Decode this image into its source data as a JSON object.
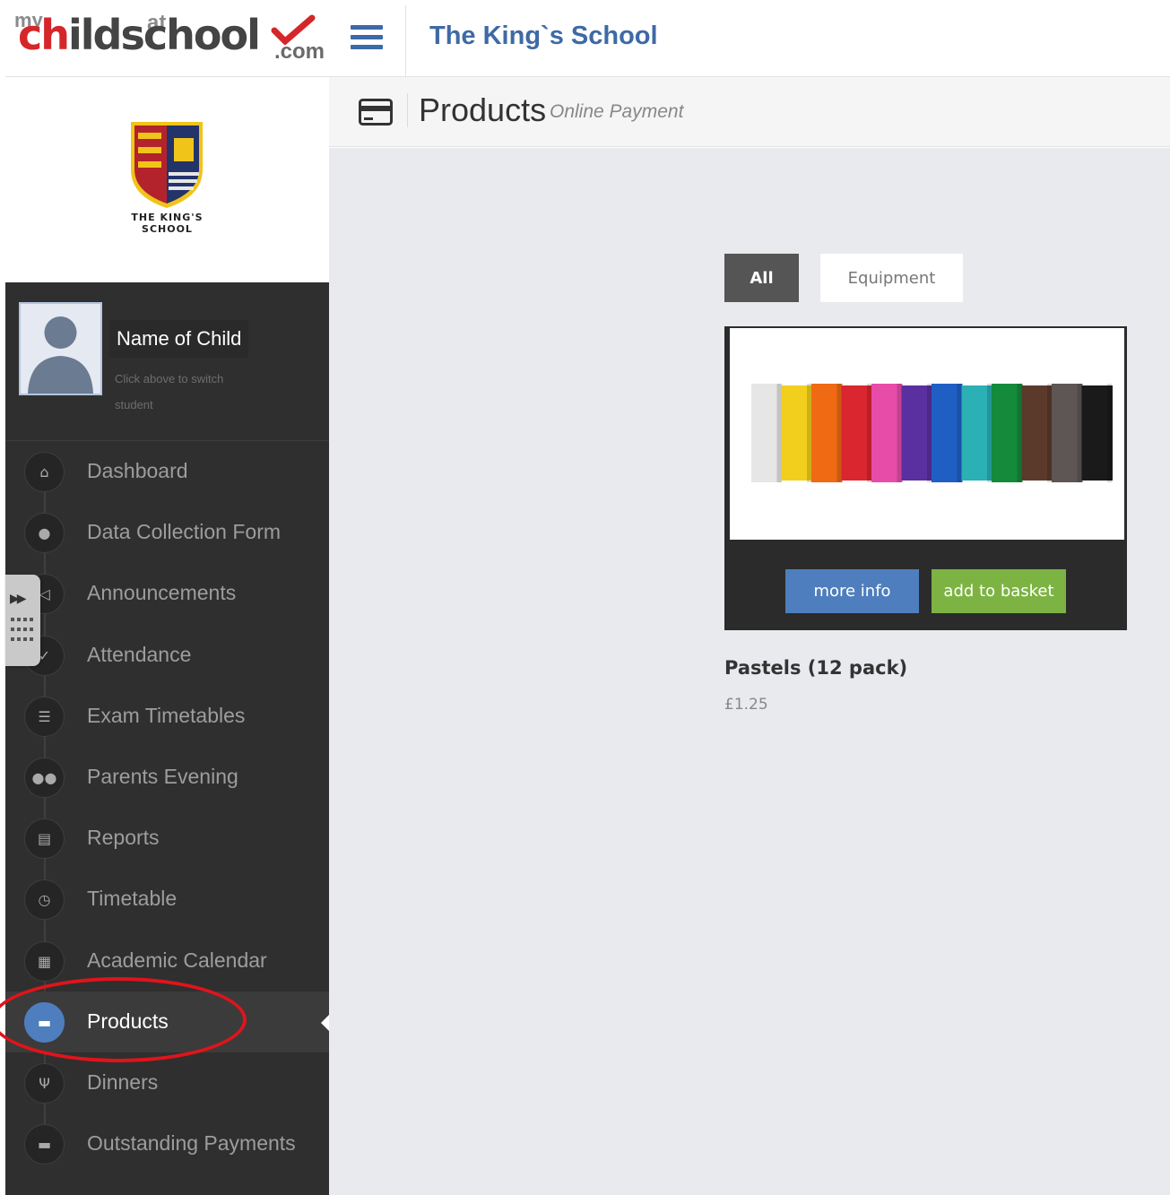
{
  "brand": {
    "logo_my": "my",
    "logo_ch": "ch",
    "logo_ild": "ild",
    "logo_at": "at",
    "logo_school": "school",
    "logo_com": ".com",
    "primary_color": "#3e6aa5",
    "accent_red": "#d5262a"
  },
  "topbar": {
    "menu_icon": "hamburger-icon",
    "school_name": "The King`s School"
  },
  "header": {
    "icon": "credit-card-icon",
    "title": "Products",
    "subtitle": "Online Payment"
  },
  "school_logo": {
    "line1": "THE KING'S",
    "line2": "SCHOOL"
  },
  "student": {
    "name": "Name of Child",
    "hint": "Click above to switch student"
  },
  "nav": {
    "items": [
      {
        "label": "Dashboard",
        "icon": "home-icon"
      },
      {
        "label": "Data Collection Form",
        "icon": "user-icon"
      },
      {
        "label": "Announcements",
        "icon": "megaphone-icon"
      },
      {
        "label": "Attendance",
        "icon": "check-icon"
      },
      {
        "label": "Exam Timetables",
        "icon": "list-icon"
      },
      {
        "label": "Parents Evening",
        "icon": "group-icon"
      },
      {
        "label": "Reports",
        "icon": "document-icon"
      },
      {
        "label": "Timetable",
        "icon": "clock-icon"
      },
      {
        "label": "Academic Calendar",
        "icon": "calendar-icon"
      },
      {
        "label": "Products",
        "icon": "credit-card-icon",
        "active": true
      },
      {
        "label": "Dinners",
        "icon": "cutlery-icon"
      },
      {
        "label": "Outstanding Payments",
        "icon": "credit-card-icon"
      }
    ]
  },
  "filters": {
    "all": "All",
    "equipment": "Equipment",
    "selected": "All"
  },
  "product": {
    "name": "Pastels (12 pack)",
    "price": "£1.25",
    "more_info": "more info",
    "add_to_basket": "add to basket",
    "pastel_colors": [
      "#e6e6e6",
      "#f2cf1d",
      "#ef6a13",
      "#d9262f",
      "#e84ca9",
      "#5a2fa0",
      "#1f5fc4",
      "#2ab0b5",
      "#148a3b",
      "#5b3a2c",
      "#5d5654",
      "#1a1a1a"
    ]
  }
}
